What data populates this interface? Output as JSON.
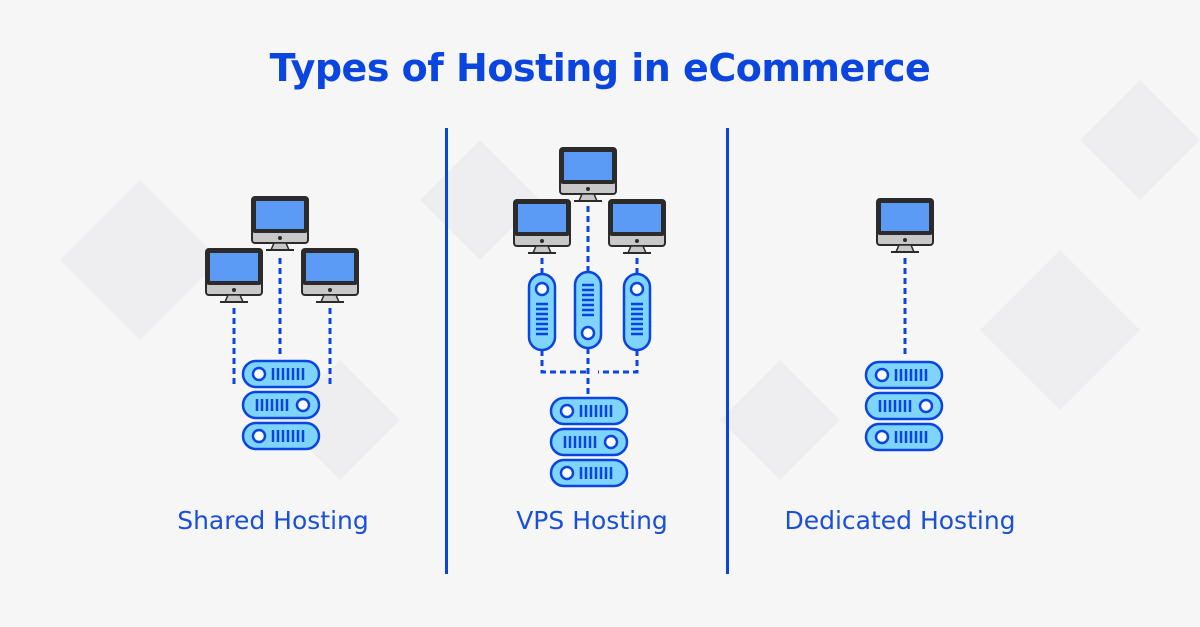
{
  "title": "Types of Hosting in eCommerce",
  "colors": {
    "accent": "#0a45e0",
    "screen": "#5b9bf5",
    "monitor_frame": "#2b2b2b",
    "monitor_base": "#c8c8c8",
    "server_fill": "#7fd4fb",
    "server_stroke": "#0a45e0",
    "background": "#f6f6f7"
  },
  "panels": [
    {
      "id": "shared",
      "label": "Shared Hosting",
      "computers": 3,
      "virtual_servers": 0,
      "server_units": 3
    },
    {
      "id": "vps",
      "label": "VPS Hosting",
      "computers": 3,
      "virtual_servers": 3,
      "server_units": 3
    },
    {
      "id": "dedicated",
      "label": "Dedicated Hosting",
      "computers": 1,
      "virtual_servers": 0,
      "server_units": 3
    }
  ]
}
